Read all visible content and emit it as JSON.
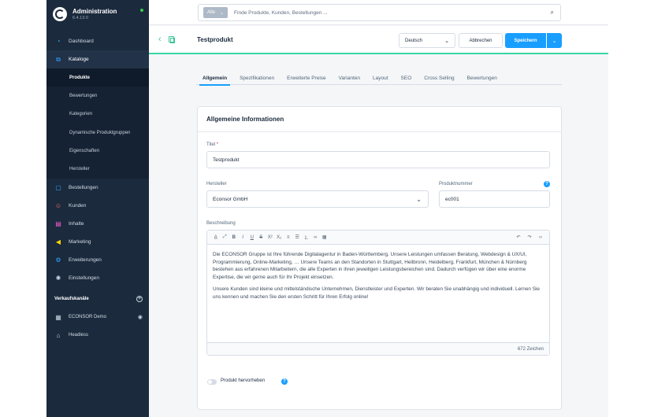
{
  "brand": {
    "title": "Administration",
    "version": "6.4.13.0"
  },
  "nav": {
    "items": [
      {
        "label": "Dashboard",
        "icon": "gauge-icon"
      },
      {
        "label": "Kataloge",
        "icon": "catalog-icon"
      }
    ],
    "kataloge_sub": [
      "Produkte",
      "Bewertungen",
      "Kategorien",
      "Dynamische Produktgruppen",
      "Eigenschaften",
      "Hersteller"
    ],
    "items_after": [
      {
        "label": "Bestellungen",
        "icon": "bag-icon"
      },
      {
        "label": "Kunden",
        "icon": "users-icon"
      },
      {
        "label": "Inhalte",
        "icon": "content-icon"
      },
      {
        "label": "Marketing",
        "icon": "megaphone-icon"
      },
      {
        "label": "Erweiterungen",
        "icon": "plugin-icon"
      },
      {
        "label": "Einstellungen",
        "icon": "gear-icon"
      }
    ],
    "sales_channels_label": "Verkaufskanäle",
    "channels": [
      "ECONSOR Demo",
      "Headless"
    ]
  },
  "search": {
    "scope": "Alle",
    "placeholder": "Finde Produkte, Kunden, Bestellungen ..."
  },
  "smartbar": {
    "title": "Testprodukt",
    "language": "Deutsch",
    "cancel": "Abbrechen",
    "save": "Speichern"
  },
  "tabs": [
    "Allgemein",
    "Spezifikationen",
    "Erweiterte Preise",
    "Varianten",
    "Layout",
    "SEO",
    "Cross Selling",
    "Bewertungen"
  ],
  "card": {
    "title": "Allgemeine Informationen",
    "title_label": "Titel",
    "title_value": "Testprodukt",
    "manufacturer_label": "Hersteller",
    "manufacturer_value": "Econsor GmbH",
    "product_number_label": "Produktnummer",
    "product_number_value": "ec001",
    "description_label": "Beschreibung",
    "description_p1": "Die ECONSOR Gruppe ist Ihre führende Digitalagentur in Baden-Württemberg. Unsere Leistungen umfassen Beratung, Webdesign & UX/UI, Programmierung, Online-Marketing, … Unsere Teams an den Standorten in Stuttgart, Heilbronn, Heidelberg, Frankfurt, München & Nürnberg bestehen aus erfahrenen Mitarbeitern, die alle Experten in ihren jeweiligen Leistungsbereichen sind. Dadurch verfügen wir über eine enorme Expertise, die wir gerne auch für Ihr Projekt einsetzen.",
    "description_p2": "Unsere Kunden sind kleine und mittelständische Unternehmen, Dienstleister und Experten. Wir beraten Sie unabhängig und individuell. Lernen Sie uns kennen und machen Sie den ersten Schritt für Ihren Erfolg online!",
    "char_count": "672 Zeichen",
    "highlight_label": "Produkt hervorheben"
  },
  "colors": {
    "sidebar": "#1b2a3d",
    "accent": "#189eff",
    "success": "#37d6a3"
  }
}
